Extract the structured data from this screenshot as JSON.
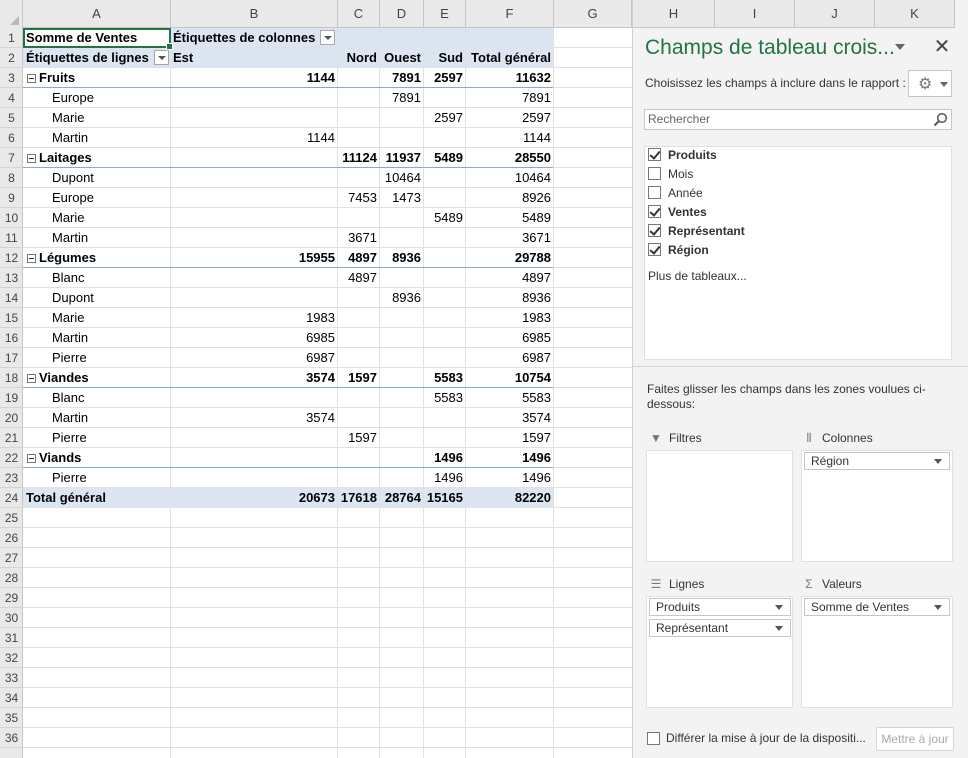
{
  "columns": [
    "A",
    "B",
    "C",
    "D",
    "E",
    "F",
    "G",
    "H",
    "I",
    "J",
    "K"
  ],
  "rows": [
    "1",
    "2",
    "3",
    "4",
    "5",
    "6",
    "7",
    "8",
    "9",
    "10",
    "11",
    "12",
    "13",
    "14",
    "15",
    "16",
    "17",
    "18",
    "19",
    "20",
    "21",
    "22",
    "23",
    "24",
    "25",
    "26",
    "27",
    "28",
    "29",
    "30",
    "31",
    "32",
    "33",
    "34",
    "35",
    "36"
  ],
  "pivot": {
    "corner": "Somme de Ventes",
    "col_labels": "Étiquettes de colonnes",
    "row_labels": "Étiquettes de lignes",
    "headers": [
      "Est",
      "Nord",
      "Ouest",
      "Sud",
      "Total général"
    ],
    "body": [
      {
        "label": "Fruits",
        "type": "group",
        "values": [
          "1144",
          "",
          "7891",
          "2597",
          "11632"
        ]
      },
      {
        "label": "Europe",
        "type": "item",
        "values": [
          "",
          "",
          "7891",
          "",
          "7891"
        ]
      },
      {
        "label": "Marie",
        "type": "item",
        "values": [
          "",
          "",
          "",
          "2597",
          "2597"
        ]
      },
      {
        "label": "Martin",
        "type": "item",
        "values": [
          "1144",
          "",
          "",
          "",
          "1144"
        ]
      },
      {
        "label": "Laitages",
        "type": "group",
        "values": [
          "",
          "11124",
          "11937",
          "5489",
          "28550"
        ]
      },
      {
        "label": "Dupont",
        "type": "item",
        "values": [
          "",
          "",
          "10464",
          "",
          "10464"
        ]
      },
      {
        "label": "Europe",
        "type": "item",
        "values": [
          "",
          "7453",
          "1473",
          "",
          "8926"
        ]
      },
      {
        "label": "Marie",
        "type": "item",
        "values": [
          "",
          "",
          "",
          "5489",
          "5489"
        ]
      },
      {
        "label": "Martin",
        "type": "item",
        "values": [
          "",
          "3671",
          "",
          "",
          "3671"
        ]
      },
      {
        "label": "Légumes",
        "type": "group",
        "values": [
          "15955",
          "4897",
          "8936",
          "",
          "29788"
        ]
      },
      {
        "label": "Blanc",
        "type": "item",
        "values": [
          "",
          "4897",
          "",
          "",
          "4897"
        ]
      },
      {
        "label": "Dupont",
        "type": "item",
        "values": [
          "",
          "",
          "8936",
          "",
          "8936"
        ]
      },
      {
        "label": "Marie",
        "type": "item",
        "values": [
          "1983",
          "",
          "",
          "",
          "1983"
        ]
      },
      {
        "label": "Martin",
        "type": "item",
        "values": [
          "6985",
          "",
          "",
          "",
          "6985"
        ]
      },
      {
        "label": "Pierre",
        "type": "item",
        "values": [
          "6987",
          "",
          "",
          "",
          "6987"
        ]
      },
      {
        "label": "Viandes",
        "type": "group",
        "values": [
          "3574",
          "1597",
          "",
          "5583",
          "10754"
        ]
      },
      {
        "label": "Blanc",
        "type": "item",
        "values": [
          "",
          "",
          "",
          "5583",
          "5583"
        ]
      },
      {
        "label": "Martin",
        "type": "item",
        "values": [
          "3574",
          "",
          "",
          "",
          "3574"
        ]
      },
      {
        "label": "Pierre",
        "type": "item",
        "values": [
          "",
          "1597",
          "",
          "",
          "1597"
        ]
      },
      {
        "label": "Viands",
        "type": "group",
        "values": [
          "",
          "",
          "",
          "1496",
          "1496"
        ]
      },
      {
        "label": "Pierre",
        "type": "item",
        "values": [
          "",
          "",
          "",
          "1496",
          "1496"
        ]
      },
      {
        "label": "Total général",
        "type": "total",
        "values": [
          "20673",
          "17618",
          "28764",
          "15165",
          "82220"
        ]
      }
    ]
  },
  "pane": {
    "title": "Champs de tableau crois...",
    "choose_text": "Choisissez les champs à inclure dans le rapport :",
    "search_placeholder": "Rechercher",
    "fields": [
      {
        "label": "Produits",
        "checked": true
      },
      {
        "label": "Mois",
        "checked": false
      },
      {
        "label": "Année",
        "checked": false
      },
      {
        "label": "Ventes",
        "checked": true
      },
      {
        "label": "Représentant",
        "checked": true
      },
      {
        "label": "Région",
        "checked": true
      }
    ],
    "more_tables": "Plus de tableaux...",
    "drag_text": "Faites glisser les champs dans les zones voulues ci-dessous:",
    "areas": {
      "filters": {
        "label": "Filtres",
        "items": []
      },
      "columns": {
        "label": "Colonnes",
        "items": [
          "Région"
        ]
      },
      "rows": {
        "label": "Lignes",
        "items": [
          "Produits",
          "Représentant"
        ]
      },
      "values": {
        "label": "Valeurs",
        "items": [
          "Somme de Ventes"
        ]
      }
    },
    "defer_label": "Différer la mise à jour de la dispositi...",
    "update_button": "Mettre à jour"
  },
  "colors": {
    "accent": "#217346",
    "band": "#dce6f3"
  }
}
